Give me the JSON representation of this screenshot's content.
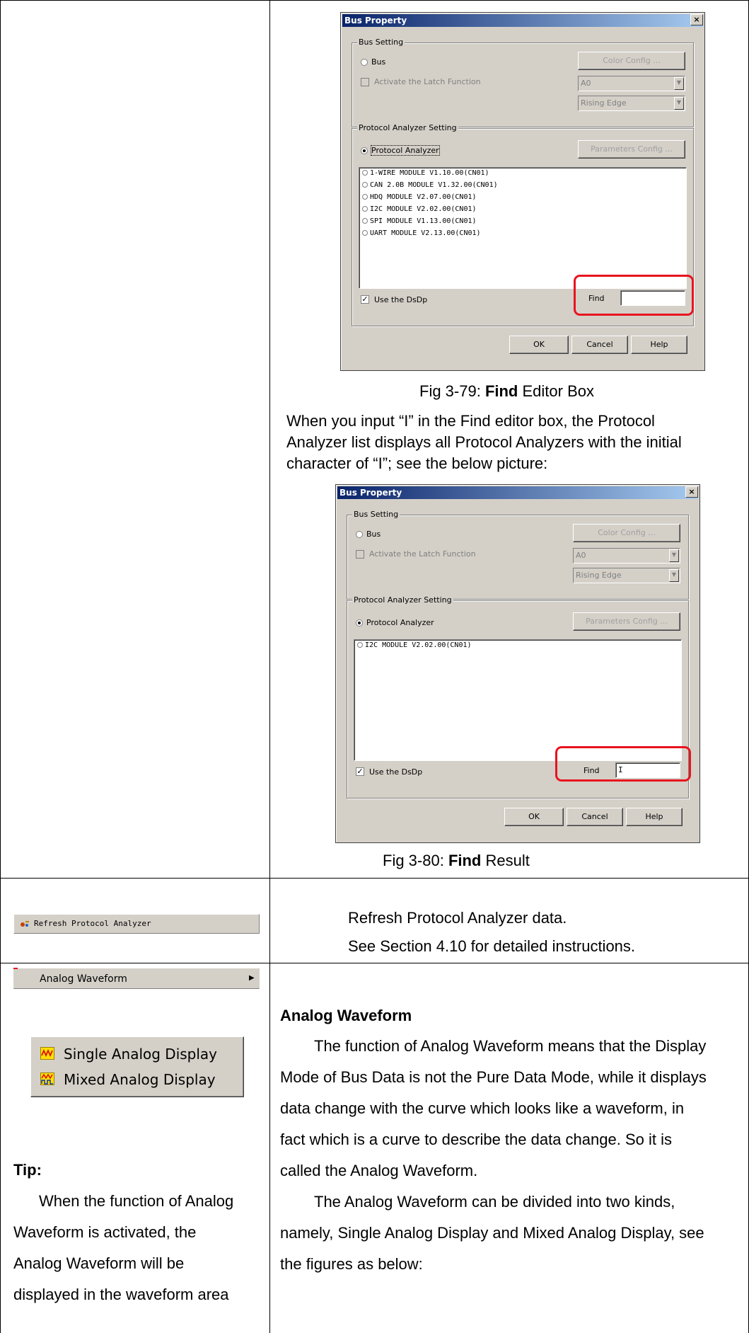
{
  "row1": {
    "dialog1": {
      "title": "Bus Property",
      "close_glyph": "×",
      "bus_setting_title": "Bus Setting",
      "bus_radio_label": "Bus",
      "color_config_button": "Color Config ...",
      "latch_label": "Activate the Latch Function",
      "latch_combo_value": "A0",
      "edge_combo_value": "Rising Edge",
      "protocol_setting_title": "Protocol Analyzer Setting",
      "protocol_radio_label": "Protocol Analyzer",
      "parameters_config_button": "Parameters Config ...",
      "list_items": [
        "1-WIRE MODULE V1.10.00(CN01)",
        "CAN 2.0B MODULE V1.32.00(CN01)",
        "HDQ MODULE V2.07.00(CN01)",
        "I2C MODULE V2.02.00(CN01)",
        "SPI MODULE V1.13.00(CN01)",
        "UART MODULE V2.13.00(CN01)"
      ],
      "use_dsdp_label": "Use the DsDp",
      "use_dsdp_check": "✓",
      "find_label": "Find",
      "find_value": "",
      "ok_button": "OK",
      "cancel_button": "Cancel",
      "help_button": "Help"
    },
    "caption1_prefix": "Fig 3-79: ",
    "caption1_bold": "Find",
    "caption1_suffix": " Editor Box",
    "description_lines": [
      "When you input “I” in the Find editor box, the Protocol",
      "Analyzer list displays all Protocol Analyzers with the initial",
      "character of “I”; see the below picture:"
    ],
    "dialog2": {
      "title": "Bus Property",
      "close_glyph": "×",
      "bus_setting_title": "Bus Setting",
      "bus_radio_label": "Bus",
      "color_config_button": "Color Config ...",
      "latch_label": "Activate the Latch Function",
      "latch_combo_value": "A0",
      "edge_combo_value": "Rising Edge",
      "protocol_setting_title": "Protocol Analyzer Setting",
      "protocol_radio_label": "Protocol Analyzer",
      "parameters_config_button": "Parameters Config ...",
      "list_items": [
        "I2C MODULE V2.02.00(CN01)"
      ],
      "use_dsdp_label": "Use the DsDp",
      "use_dsdp_check": "✓",
      "find_label": "Find",
      "find_value": "I",
      "ok_button": "OK",
      "cancel_button": "Cancel",
      "help_button": "Help"
    },
    "caption2_prefix": "Fig 3-80: ",
    "caption2_bold": "Find",
    "caption2_suffix": " Result"
  },
  "row2": {
    "menu_item_label": "Refresh Protocol Analyzer",
    "lines": [
      "Refresh Protocol Analyzer data.",
      "See Section 4.10 for detailed instructions."
    ]
  },
  "row3": {
    "menu_item_label": "Analog Waveform",
    "submenu_arrow": "▶",
    "submenu_items": [
      "Single Analog Display",
      "Mixed Analog Display"
    ],
    "tip_heading": "Tip:",
    "tip_lines": [
      "When the function of Analog",
      "Waveform is activated, the",
      "Analog Waveform will be",
      "displayed in the waveform area"
    ],
    "heading": "Analog Waveform",
    "paragraph_lines": [
      "The function of Analog Waveform means that the Display",
      "Mode of Bus Data is not the Pure Data Mode, while it displays",
      "data change with the curve which looks like a waveform, in",
      "fact which is a curve to describe the data change. So it is",
      "called the Analog Waveform.",
      "The Analog Waveform can be divided into two kinds,",
      "namely, Single Analog Display and Mixed Analog Display, see",
      "the figures as below:"
    ]
  },
  "colors": {
    "highlight": "#e8141e",
    "dialog_face": "#d4d0c8",
    "titlebar_start": "#0a246a",
    "titlebar_end": "#a6caf0"
  }
}
